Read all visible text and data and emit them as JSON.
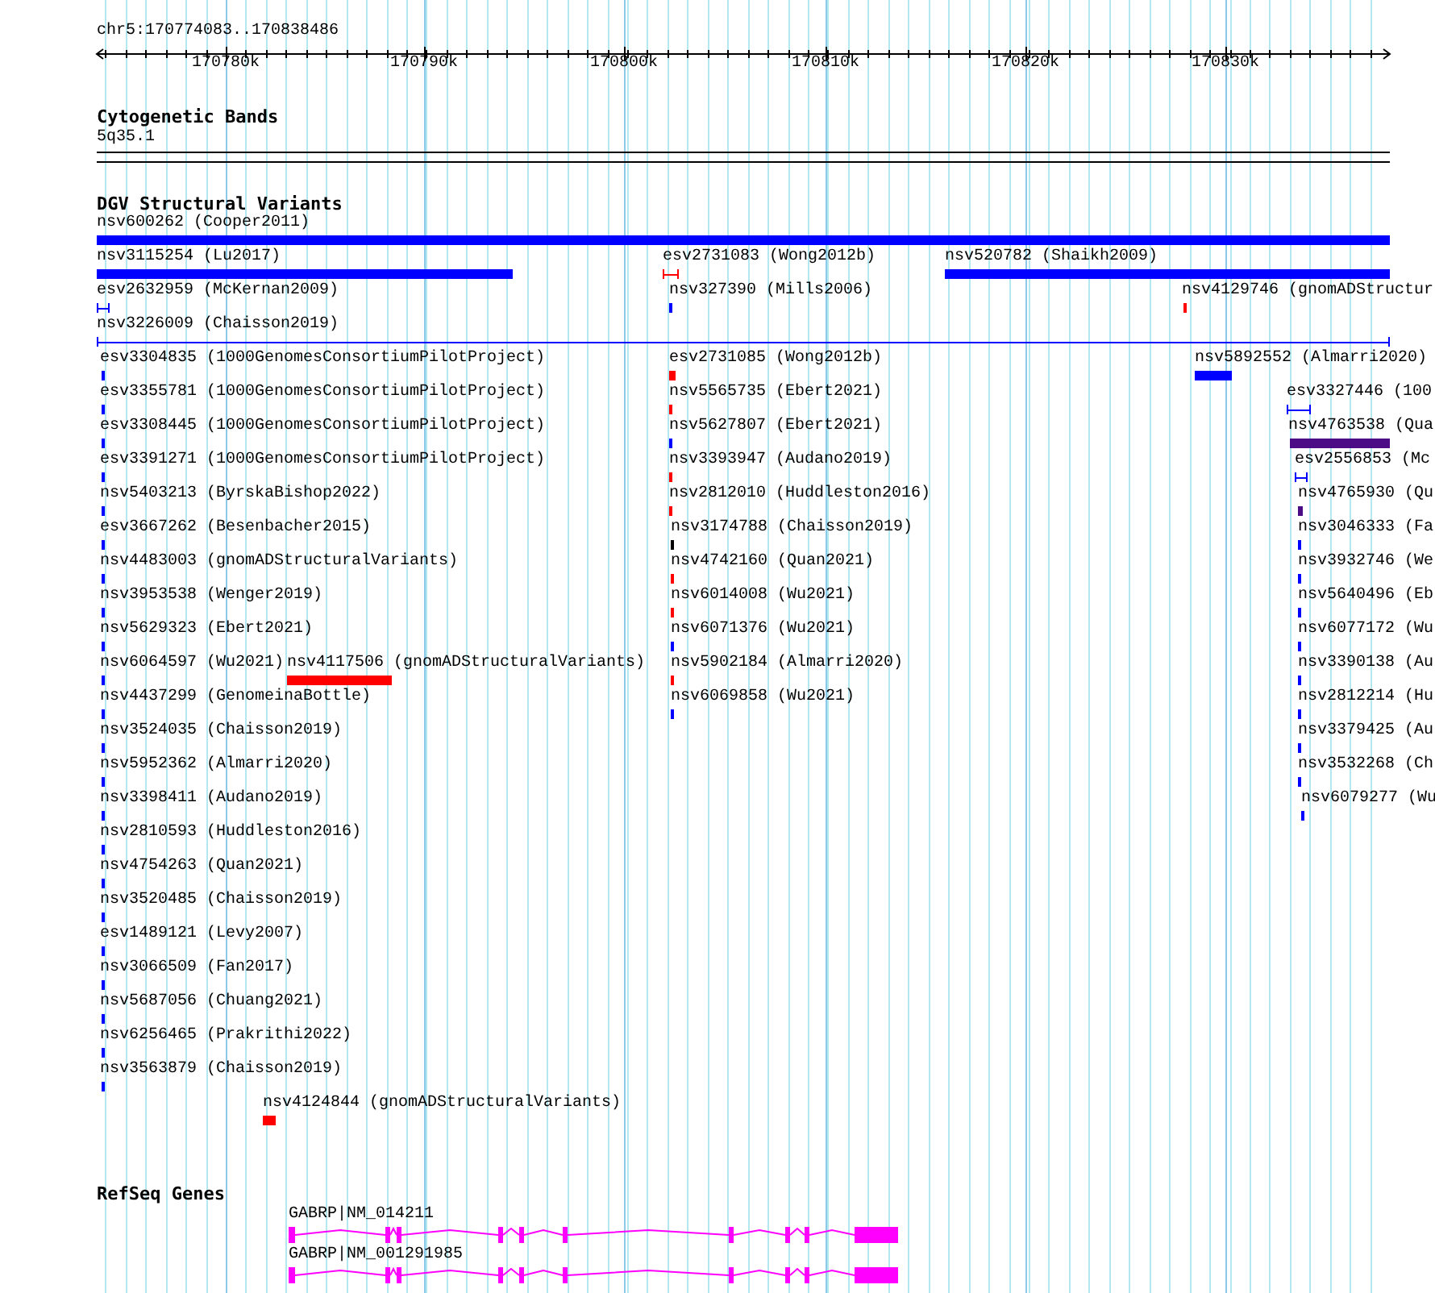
{
  "ruler": {
    "location": "chr5:170774083..170838486",
    "ticks": [
      "170780k",
      "170790k",
      "170800k",
      "170810k",
      "170820k",
      "170830k"
    ]
  },
  "tracks": [
    {
      "kind": "bands",
      "title": "Cytogenetic Bands",
      "features": [
        {
          "label": "5q35.1"
        }
      ]
    },
    {
      "kind": "variants",
      "title": "DGV Structural Variants",
      "features": [
        {
          "label": "nsv600262 (Cooper2011)",
          "color": "#0000ff"
        },
        {
          "label": "nsv3115254 (Lu2017)",
          "color": "#0000ff"
        },
        {
          "label": "esv2731083 (Wong2012b)",
          "color": "#ff0000"
        },
        {
          "label": "nsv520782 (Shaikh2009)",
          "color": "#0000ff"
        },
        {
          "label": "esv2632959 (McKernan2009)",
          "color": "#0000ff"
        },
        {
          "label": "nsv327390 (Mills2006)",
          "color": "#0000ff"
        },
        {
          "label": "nsv4129746 (gnomADStructur",
          "color": "#ff0000"
        },
        {
          "label": "nsv3226009 (Chaisson2019)",
          "color": "#0000ff"
        },
        {
          "label": "esv3304835 (1000GenomesConsortiumPilotProject)",
          "color": "#0000ff"
        },
        {
          "label": "esv2731085 (Wong2012b)",
          "color": "#ff0000"
        },
        {
          "label": "nsv5892552 (Almarri2020)",
          "color": "#0000ff"
        },
        {
          "label": "esv3355781 (1000GenomesConsortiumPilotProject)",
          "color": "#0000ff"
        },
        {
          "label": "nsv5565735 (Ebert2021)",
          "color": "#ff0000"
        },
        {
          "label": "esv3327446 (100",
          "color": "#0000ff"
        },
        {
          "label": "esv3308445 (1000GenomesConsortiumPilotProject)",
          "color": "#0000ff"
        },
        {
          "label": "nsv5627807 (Ebert2021)",
          "color": "#0000ff"
        },
        {
          "label": "nsv4763538 (Qua",
          "color": "#4b0c86"
        },
        {
          "label": "esv3391271 (1000GenomesConsortiumPilotProject)",
          "color": "#0000ff"
        },
        {
          "label": "nsv3393947 (Audano2019)",
          "color": "#ff0000"
        },
        {
          "label": "esv2556853 (Mc",
          "color": "#0000ff"
        },
        {
          "label": "nsv5403213 (ByrskaBishop2022)",
          "color": "#0000ff"
        },
        {
          "label": "nsv2812010 (Huddleston2016)",
          "color": "#ff0000"
        },
        {
          "label": "nsv4765930 (Qu",
          "color": "#4b0c86"
        },
        {
          "label": "esv3667262 (Besenbacher2015)",
          "color": "#0000ff"
        },
        {
          "label": "nsv3174788 (Chaisson2019)",
          "color": "#000000"
        },
        {
          "label": "nsv3046333 (Fa",
          "color": "#0000ff"
        },
        {
          "label": "nsv4483003 (gnomADStructuralVariants)",
          "color": "#0000ff"
        },
        {
          "label": "nsv4742160 (Quan2021)",
          "color": "#ff0000"
        },
        {
          "label": "nsv3932746 (We",
          "color": "#0000ff"
        },
        {
          "label": "nsv3953538 (Wenger2019)",
          "color": "#0000ff"
        },
        {
          "label": "nsv6014008 (Wu2021)",
          "color": "#ff0000"
        },
        {
          "label": "nsv5640496 (Eb",
          "color": "#0000ff"
        },
        {
          "label": "nsv5629323 (Ebert2021)",
          "color": "#0000ff"
        },
        {
          "label": "nsv6071376 (Wu2021)",
          "color": "#0000ff"
        },
        {
          "label": "nsv6077172 (Wu",
          "color": "#0000ff"
        },
        {
          "label": "nsv6064597 (Wu2021)",
          "color": "#0000ff"
        },
        {
          "label": "nsv4117506 (gnomADStructuralVariants)",
          "color": "#ff0000"
        },
        {
          "label": "nsv5902184 (Almarri2020)",
          "color": "#ff0000"
        },
        {
          "label": "nsv3390138 (Au",
          "color": "#0000ff"
        },
        {
          "label": "nsv4437299 (GenomeinaBottle)",
          "color": "#0000ff"
        },
        {
          "label": "nsv6069858 (Wu2021)",
          "color": "#0000ff"
        },
        {
          "label": "nsv2812214 (Hu",
          "color": "#0000ff"
        },
        {
          "label": "nsv3524035 (Chaisson2019)",
          "color": "#0000ff"
        },
        {
          "label": "nsv3379425 (Au",
          "color": "#0000ff"
        },
        {
          "label": "nsv5952362 (Almarri2020)",
          "color": "#0000ff"
        },
        {
          "label": "nsv3532268 (Ch",
          "color": "#0000ff"
        },
        {
          "label": "nsv3398411 (Audano2019)",
          "color": "#0000ff"
        },
        {
          "label": "nsv6079277 (Wu",
          "color": "#0000ff"
        },
        {
          "label": "nsv2810593 (Huddleston2016)",
          "color": "#0000ff"
        },
        {
          "label": "nsv4754263 (Quan2021)",
          "color": "#0000ff"
        },
        {
          "label": "nsv3520485 (Chaisson2019)",
          "color": "#0000ff"
        },
        {
          "label": "esv1489121 (Levy2007)",
          "color": "#0000ff"
        },
        {
          "label": "nsv3066509 (Fan2017)",
          "color": "#0000ff"
        },
        {
          "label": "nsv5687056 (Chuang2021)",
          "color": "#0000ff"
        },
        {
          "label": "nsv6256465 (Prakrithi2022)",
          "color": "#0000ff"
        },
        {
          "label": "nsv3563879 (Chaisson2019)",
          "color": "#0000ff"
        },
        {
          "label": "nsv4124844 (gnomADStructuralVariants)",
          "color": "#ff0000"
        }
      ]
    },
    {
      "kind": "genes",
      "title": "RefSeq Genes",
      "features": [
        {
          "label": "GABRP|NM_014211"
        },
        {
          "label": "GABRP|NM_001291985"
        }
      ]
    }
  ]
}
